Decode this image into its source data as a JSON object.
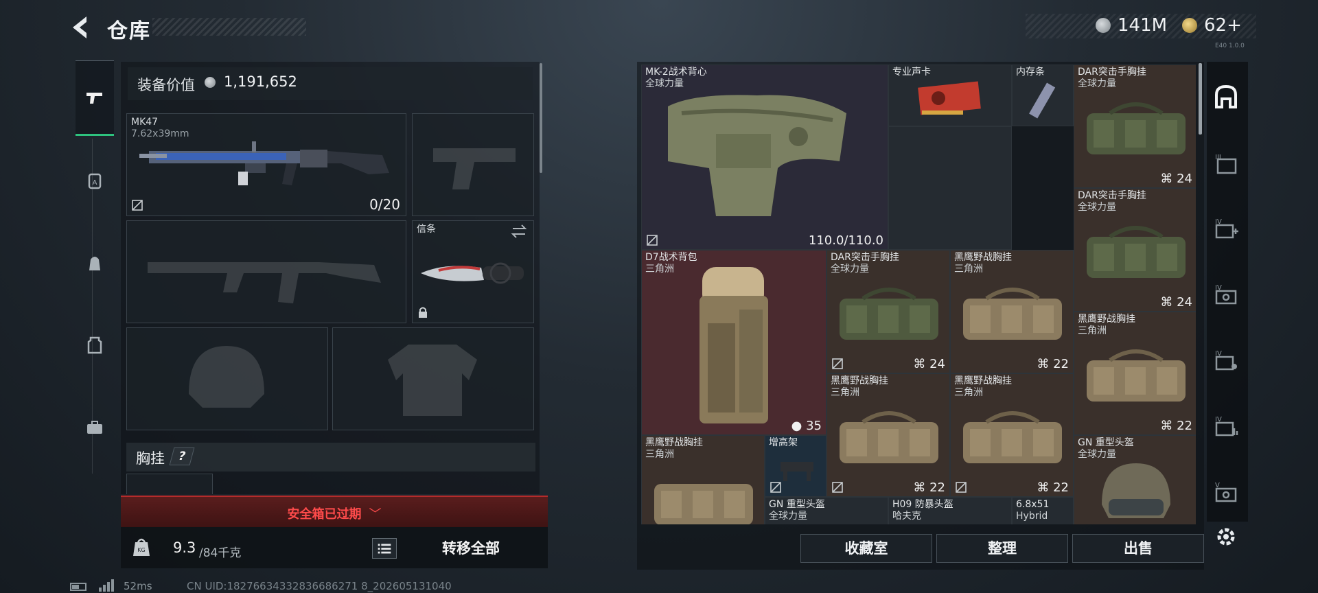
{
  "header": {
    "title": "仓库",
    "currency_silver": "141M",
    "currency_gold": "62+",
    "version_tag": "E40 1.0.0"
  },
  "left_nav": {
    "items": [
      {
        "icon": "pistol-icon",
        "active": true
      },
      {
        "icon": "backpack-a-icon",
        "active": false
      },
      {
        "icon": "backpack-icon",
        "active": false
      },
      {
        "icon": "armor-vest-icon",
        "active": false
      },
      {
        "icon": "briefcase-icon",
        "active": false
      }
    ]
  },
  "equipment": {
    "value_label": "装备价值",
    "value": "1,191,652",
    "primary": {
      "name": "MK47",
      "ammo": "7.62x39mm",
      "count": "0/20"
    },
    "melee": {
      "label": "信条"
    },
    "chest_label": "胸挂",
    "chest_help": "?",
    "safe_box_text": "安全箱已过期",
    "weight_current": "9.3",
    "weight_max": "/84千克",
    "transfer_all": "转移全部"
  },
  "status": {
    "ping": "52ms",
    "uid": "CN UID:18276634332836686271 8_202605131040"
  },
  "storage": {
    "items": [
      {
        "id": "mk2",
        "name": "MK-2战术背心",
        "sub": "全球力量",
        "stat": "110.0/110.0"
      },
      {
        "id": "gpu",
        "name": "专业声卡",
        "sub": "",
        "stat": ""
      },
      {
        "id": "ram",
        "name": "内存条",
        "sub": "",
        "stat": ""
      },
      {
        "id": "dar1",
        "name": "DAR突击手胸挂",
        "sub": "全球力量",
        "stat": "24"
      },
      {
        "id": "dar2",
        "name": "DAR突击手胸挂",
        "sub": "全球力量",
        "stat": "24"
      },
      {
        "id": "d7",
        "name": "D7战术背包",
        "sub": "三角洲",
        "stat": "35"
      },
      {
        "id": "dar3",
        "name": "DAR突击手胸挂",
        "sub": "全球力量",
        "stat": "24"
      },
      {
        "id": "hy1",
        "name": "黑鹰野战胸挂",
        "sub": "三角洲",
        "stat": "22"
      },
      {
        "id": "hy2",
        "name": "黑鹰野战胸挂",
        "sub": "三角洲",
        "stat": "22"
      },
      {
        "id": "hy3",
        "name": "黑鹰野战胸挂",
        "sub": "三角洲",
        "stat": "22"
      },
      {
        "id": "hy4",
        "name": "黑鹰野战胸挂",
        "sub": "三角洲",
        "stat": "22"
      },
      {
        "id": "hy5",
        "name": "黑鹰野战胸挂",
        "sub": "三角洲",
        "stat": ""
      },
      {
        "id": "zgj",
        "name": "增高架",
        "sub": "",
        "stat": ""
      },
      {
        "id": "gn1",
        "name": "GN 重型头盔",
        "sub": "全球力量",
        "stat": ""
      },
      {
        "id": "gn2",
        "name": "GN 重型头盔",
        "sub": "全球力量",
        "stat": ""
      },
      {
        "id": "h09",
        "name": "H09 防暴头盔",
        "sub": "哈夫克",
        "stat": ""
      },
      {
        "id": "ammo",
        "name": "6.8x51",
        "sub": "Hybrid",
        "stat": ""
      }
    ]
  },
  "buttons": {
    "collection": "收藏室",
    "sort": "整理",
    "sell": "出售"
  }
}
